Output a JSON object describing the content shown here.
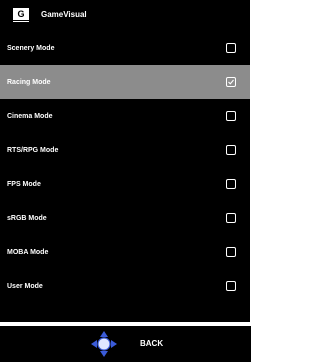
{
  "header": {
    "logo_letter": "G",
    "title": "GameVisual"
  },
  "modes": [
    {
      "label": "Scenery Mode",
      "checked": false
    },
    {
      "label": "Racing Mode",
      "checked": true
    },
    {
      "label": "Cinema Mode",
      "checked": false
    },
    {
      "label": "RTS/RPG Mode",
      "checked": false
    },
    {
      "label": "FPS Mode",
      "checked": false
    },
    {
      "label": "sRGB Mode",
      "checked": false
    },
    {
      "label": "MOBA Mode",
      "checked": false
    },
    {
      "label": "User Mode",
      "checked": false
    }
  ],
  "selected_index": 1,
  "footer": {
    "back_label": "BACK",
    "nav_icon": "four-way-navigation-icon"
  },
  "colors": {
    "background": "#000000",
    "selected_row": "#8c8c8c",
    "text": "#ffffff",
    "nav_accent": "#3a5bd9"
  }
}
